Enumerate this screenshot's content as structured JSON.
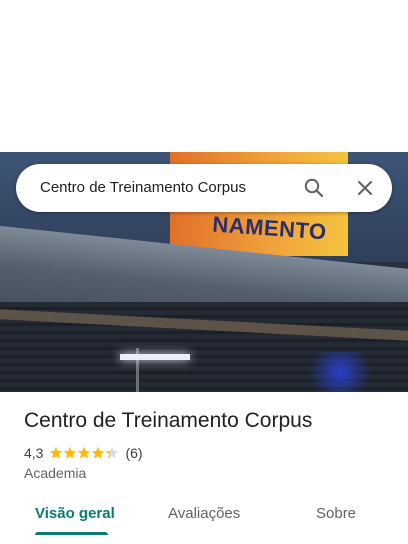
{
  "search": {
    "query": "Centro de Treinamento Corpus"
  },
  "hero": {
    "sign_text": "NAMENTO"
  },
  "place": {
    "title": "Centro de Treinamento Corpus",
    "rating": "4,3",
    "rating_stars": 4.3,
    "review_count": "(6)",
    "category": "Academia"
  },
  "tabs": [
    {
      "label": "Visão geral"
    },
    {
      "label": "Avaliações"
    },
    {
      "label": "Sobre"
    }
  ],
  "colors": {
    "accent": "#0b7a75",
    "star": "#fbbc04",
    "star_empty": "#dadce0"
  }
}
